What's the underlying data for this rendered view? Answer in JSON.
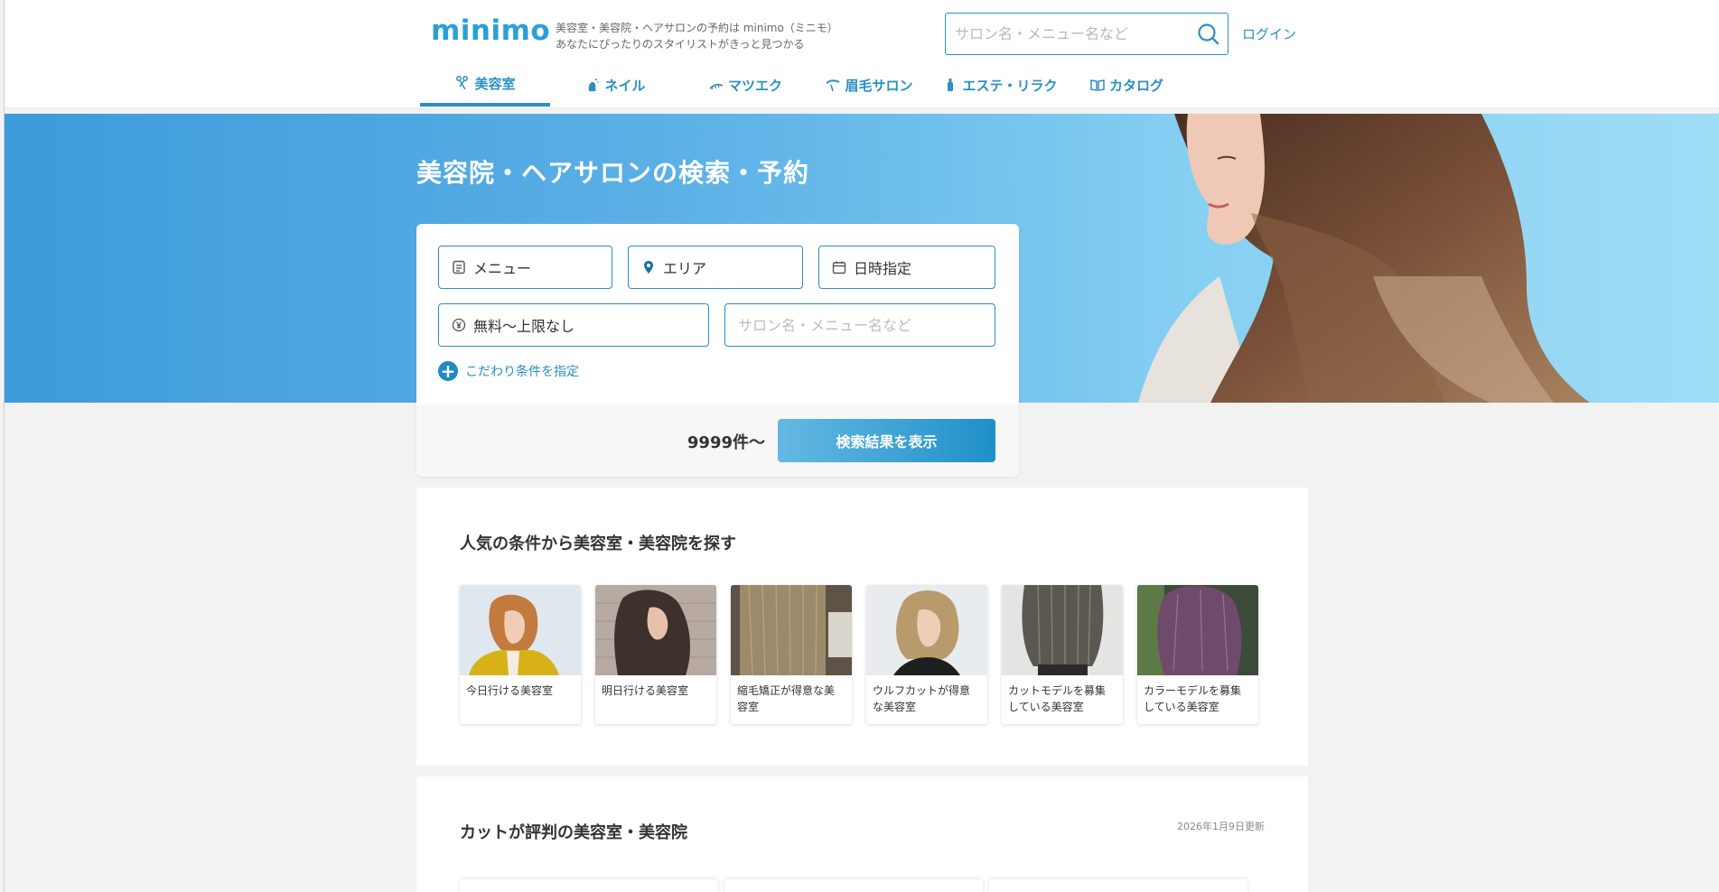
{
  "header": {
    "logo": "minimo",
    "tagline_line1": "美容室・美容院・ヘアサロンの予約は minimo（ミニモ）",
    "tagline_line2": "あなたにぴったりのスタイリストがきっと見つかる",
    "search_placeholder": "サロン名・メニュー名など",
    "login_label": "ログイン"
  },
  "nav": {
    "items": [
      {
        "label": "美容室",
        "icon": "scissors-icon",
        "active": true
      },
      {
        "label": "ネイル",
        "icon": "nail-icon"
      },
      {
        "label": "マツエク",
        "icon": "eyelash-icon"
      },
      {
        "label": "眉毛サロン",
        "icon": "eyebrow-icon"
      },
      {
        "label": "エステ・リラク",
        "icon": "esthetic-icon"
      },
      {
        "label": "カタログ",
        "icon": "book-icon"
      }
    ]
  },
  "hero": {
    "title": "美容院・ヘアサロンの検索・予約"
  },
  "search": {
    "menu_label": "メニュー",
    "area_label": "エリア",
    "datetime_label": "日時指定",
    "price_label": "無料〜上限なし",
    "keyword_placeholder": "サロン名・メニュー名など",
    "more_conditions": "こだわり条件を指定",
    "count": "9999件〜",
    "submit_label": "検索結果を表示"
  },
  "popular": {
    "title": "人気の条件から美容室・美容院を探す",
    "cards": [
      {
        "line1": "今日行ける美容室",
        "line2": ""
      },
      {
        "line1": "明日行ける美容室",
        "line2": ""
      },
      {
        "line1": "縮毛矯正が得意な美",
        "line2": "容室"
      },
      {
        "line1": "ウルフカットが得意",
        "line2": "な美容室"
      },
      {
        "line1": "カットモデルを募集",
        "line2": "している美容室"
      },
      {
        "line1": "カラーモデルを募集",
        "line2": "している美容室"
      }
    ]
  },
  "reviews": {
    "title": "カットが評判の美容室・美容院",
    "updated": "2026年1月9日更新"
  },
  "colors": {
    "accent": "#2a8fc4",
    "logo": "#2a9fd8",
    "hero_start": "#3d9adb",
    "hero_end": "#9fdcf6"
  }
}
